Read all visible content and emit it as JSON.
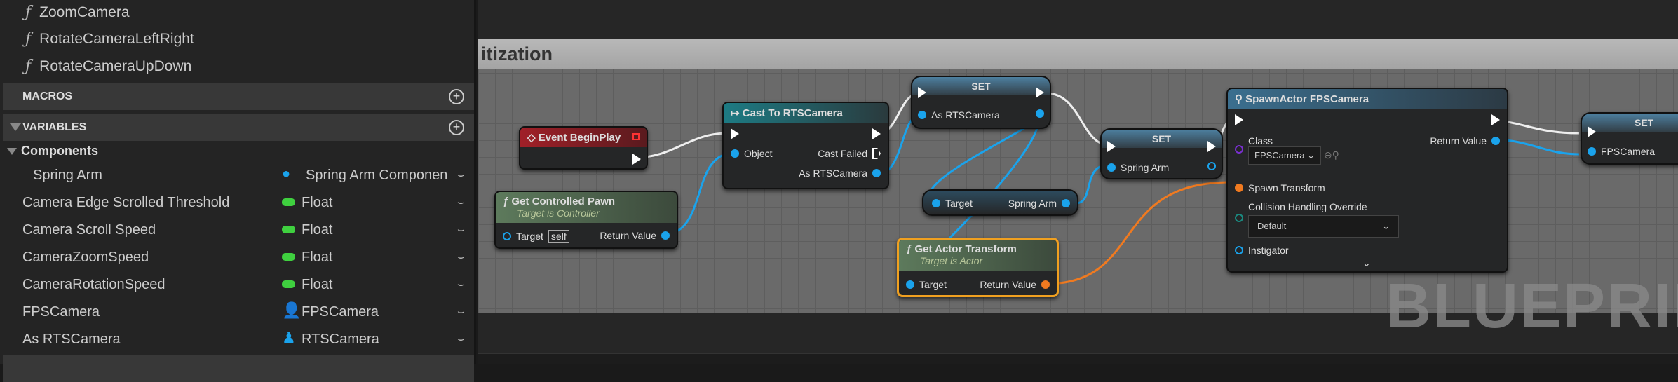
{
  "sidebar": {
    "functions": [
      "ZoomCamera",
      "RotateCameraLeftRight",
      "RotateCameraUpDown"
    ],
    "macros_label": "MACROS",
    "variables_label": "VARIABLES",
    "components_label": "Components",
    "variables": [
      {
        "name": "Spring Arm",
        "type": "Spring Arm Componen",
        "icon": "spring-arm-icon"
      },
      {
        "name": "Camera Edge Scrolled Threshold",
        "type": "Float",
        "icon": "float-pill-icon"
      },
      {
        "name": "Camera Scroll Speed",
        "type": "Float",
        "icon": "float-pill-icon"
      },
      {
        "name": "CameraZoomSpeed",
        "type": "Float",
        "icon": "float-pill-icon"
      },
      {
        "name": "CameraRotationSpeed",
        "type": "Float",
        "icon": "float-pill-icon"
      },
      {
        "name": "FPSCamera",
        "type": "FPSCamera",
        "icon": "character-icon"
      },
      {
        "name": "As RTSCamera",
        "type": "RTSCamera",
        "icon": "pawn-icon"
      }
    ]
  },
  "graph": {
    "comment_title": "itization",
    "watermark": "BLUEPRINT",
    "event_begin_play": {
      "title": "Event BeginPlay"
    },
    "get_controlled_pawn": {
      "title": "Get Controlled Pawn",
      "subtitle": "Target is Controller",
      "target": "Target",
      "self": "self",
      "return": "Return Value"
    },
    "cast": {
      "title": "Cast To RTSCamera",
      "object": "Object",
      "cast_failed": "Cast Failed",
      "as": "As RTSCamera"
    },
    "set1": {
      "title": "SET",
      "pin": "As RTSCamera"
    },
    "spring_getter": {
      "target": "Target",
      "out": "Spring Arm"
    },
    "get_actor_transform": {
      "title": "Get Actor Transform",
      "subtitle": "Target is Actor",
      "target": "Target",
      "return": "Return Value"
    },
    "set2": {
      "title": "SET",
      "pin": "Spring Arm"
    },
    "spawn": {
      "title": "SpawnActor FPSCamera",
      "class": "Class",
      "class_value": "FPSCamera",
      "return": "Return Value",
      "transform": "Spawn Transform",
      "collision": "Collision Handling Override",
      "collision_value": "Default",
      "instigator": "Instigator"
    },
    "set3": {
      "title": "SET",
      "pin": "FPSCamera"
    }
  },
  "colors": {
    "exec": "#ffffff",
    "object": "#1aa3ec",
    "transform": "#f07a20",
    "float": "#3fd03f",
    "class": "#7a2fd0"
  }
}
